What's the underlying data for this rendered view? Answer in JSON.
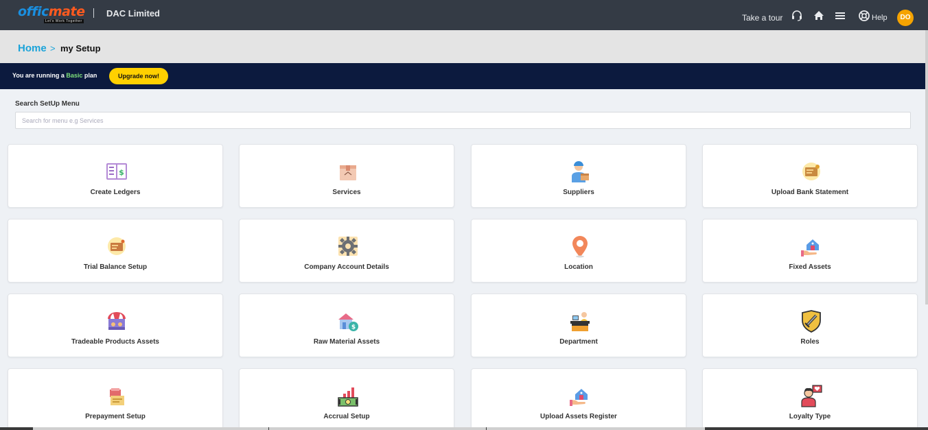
{
  "header": {
    "logo_text": "officmate",
    "logo_tagline": "Let's Work Together",
    "company": "DAC Limited",
    "take_tour": "Take a tour",
    "help": "Help",
    "avatar_initials": "DO",
    "icons": [
      "headset-icon",
      "home-icon",
      "menu-icon",
      "lifebuoy-icon"
    ]
  },
  "breadcrumb": {
    "home": "Home",
    "separator": ">",
    "current": "my Setup"
  },
  "plan": {
    "prefix": "You are running a",
    "plan_name": "Basic",
    "suffix": "plan",
    "upgrade_label": "Upgrade now!"
  },
  "search": {
    "label": "Search SetUp Menu",
    "placeholder": "Search for menu e.g Services"
  },
  "cards": [
    {
      "label": "Create Ledgers",
      "icon": "ledger-book-icon"
    },
    {
      "label": "Services",
      "icon": "box-icon"
    },
    {
      "label": "Suppliers",
      "icon": "delivery-person-icon"
    },
    {
      "label": "Upload Bank Statement",
      "icon": "bank-statement-icon"
    },
    {
      "label": "Trial Balance Setup",
      "icon": "balance-folder-icon"
    },
    {
      "label": "Company Account Details",
      "icon": "gear-icon"
    },
    {
      "label": "Location",
      "icon": "map-pin-icon"
    },
    {
      "label": "Fixed Assets",
      "icon": "house-hand-icon"
    },
    {
      "label": "Tradeable Products Assets",
      "icon": "market-stall-icon"
    },
    {
      "label": "Raw Material Assets",
      "icon": "house-coin-icon"
    },
    {
      "label": "Department",
      "icon": "reception-desk-icon"
    },
    {
      "label": "Roles",
      "icon": "shield-sword-icon"
    },
    {
      "label": "Prepayment Setup",
      "icon": "payment-stack-icon"
    },
    {
      "label": "Accrual Setup",
      "icon": "money-chart-icon"
    },
    {
      "label": "Upload Assets Register",
      "icon": "house-hand-icon"
    },
    {
      "label": "Loyalty Type",
      "icon": "person-heart-icon"
    }
  ],
  "colors": {
    "topbar": "#343b45",
    "accent_blue": "#1aa3d9",
    "plan_bar": "#0c1a3e",
    "upgrade_yellow": "#ffd000",
    "avatar_orange": "#f5a300"
  }
}
